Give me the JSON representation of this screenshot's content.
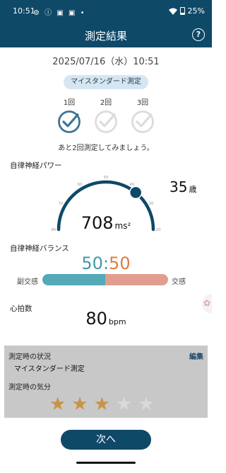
{
  "status_bar": {
    "time": "10:51",
    "icons": "⚙ ⓘ ▣ ▣ •",
    "battery": "25%"
  },
  "header": {
    "title": "測定結果",
    "help_icon": "?"
  },
  "date": "2025/07/16（水）10:51",
  "mode_chip": "マイスタンダード測定",
  "measurements": [
    {
      "label": "1回",
      "done": true
    },
    {
      "label": "2回",
      "done": false
    },
    {
      "label": "3回",
      "done": false
    }
  ],
  "hint": "あと2回測定してみましょう。",
  "power": {
    "label": "自律神経パワー",
    "value": "708",
    "unit": "ms²",
    "gauge_ticks": [
      "80",
      "70",
      "60",
      "50",
      "40",
      "30",
      "20"
    ],
    "marker_age_value": 37,
    "age_value": "35",
    "age_unit": "歳"
  },
  "balance": {
    "label": "自律神経バランス",
    "left_value": "50",
    "right_value": "50",
    "left_label": "副交感",
    "right_label": "交感",
    "left_fraction": 0.5
  },
  "heart_rate": {
    "label": "心拍数",
    "value": "80",
    "unit": "bpm"
  },
  "situation": {
    "label": "測定時の状況",
    "value": "マイスタンダード測定",
    "edit_label": "編集",
    "mood_label": "測定時の気分",
    "rating": 3,
    "rating_max": 5
  },
  "next_button": "次へ",
  "colors": {
    "primary": "#0e4968",
    "check_done": "#3d7596",
    "check_pending": "#dcdcdc",
    "balance_left": "#3f9aaa",
    "balance_right": "#e07b3c",
    "star_on": "#c99347",
    "star_off": "#dadada"
  }
}
